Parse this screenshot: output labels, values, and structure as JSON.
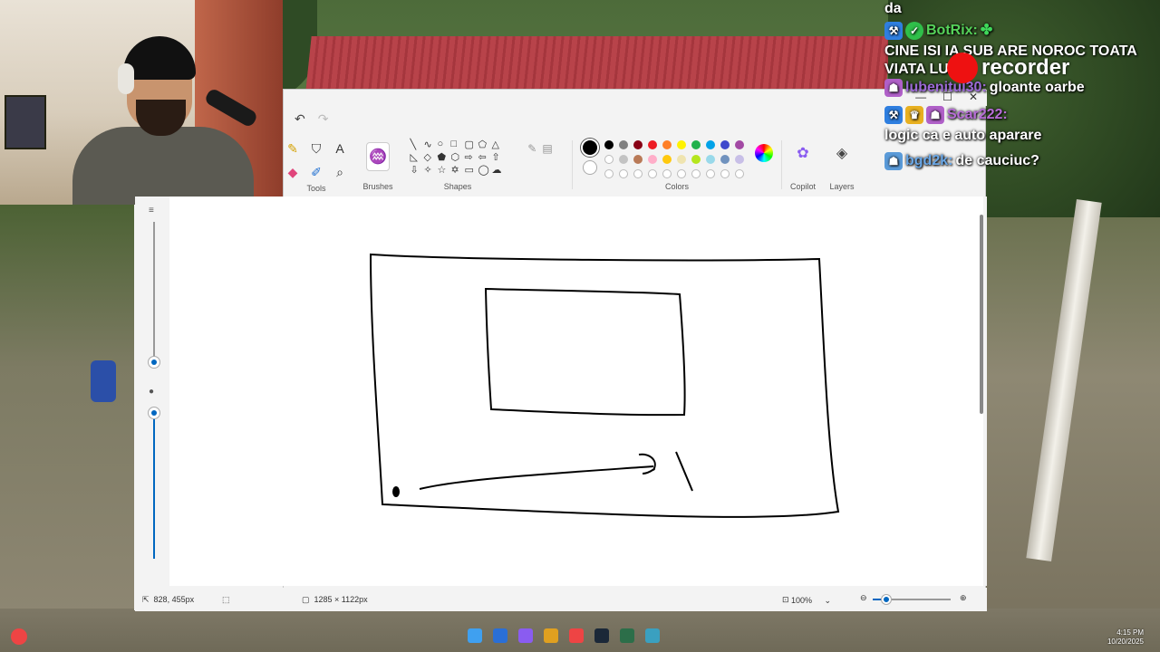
{
  "chat": {
    "lines": [
      {
        "user": "",
        "text": "da"
      },
      {
        "user": "BotRix:",
        "text": "CINE ISI IA SUB ARE NOROC TOATA VIATA LUI"
      },
      {
        "user": "lubenitul30:",
        "text": "gloante oarbe"
      },
      {
        "user": "Scar222:",
        "text": "logic ca e auto aparare"
      },
      {
        "user": "bgd2k:",
        "text": "de cauciuc?"
      }
    ],
    "recorder": "recorder"
  },
  "paint": {
    "groups": {
      "tools": "Tools",
      "brushes": "Brushes",
      "shapes": "Shapes",
      "colors": "Colors",
      "copilot": "Copilot",
      "layers": "Layers"
    },
    "palette_row1": [
      "#000000",
      "#7f7f7f",
      "#880015",
      "#ed1c24",
      "#ff7f27",
      "#fff200",
      "#22b14c",
      "#00a2e8",
      "#3f48cc",
      "#a349a4"
    ],
    "palette_row2": [
      "empty",
      "#c3c3c3",
      "#b97a57",
      "#ffaec9",
      "#ffc90e",
      "#efe4b0",
      "#b5e61d",
      "#99d9ea",
      "#7092be",
      "#c8bfe7"
    ],
    "palette_row3": [
      "empty",
      "empty",
      "empty",
      "empty",
      "empty",
      "empty",
      "empty",
      "empty",
      "empty",
      "empty"
    ],
    "primary_color": "#000000",
    "secondary_color": "#ffffff",
    "status": {
      "cursor_pos": "828, 455px",
      "canvas_size": "1285 × 1122px",
      "zoom": "100%"
    },
    "zoom_fraction": 0.16
  },
  "taskbar": {
    "time": "4:15 PM",
    "date": "10/20/2025"
  }
}
